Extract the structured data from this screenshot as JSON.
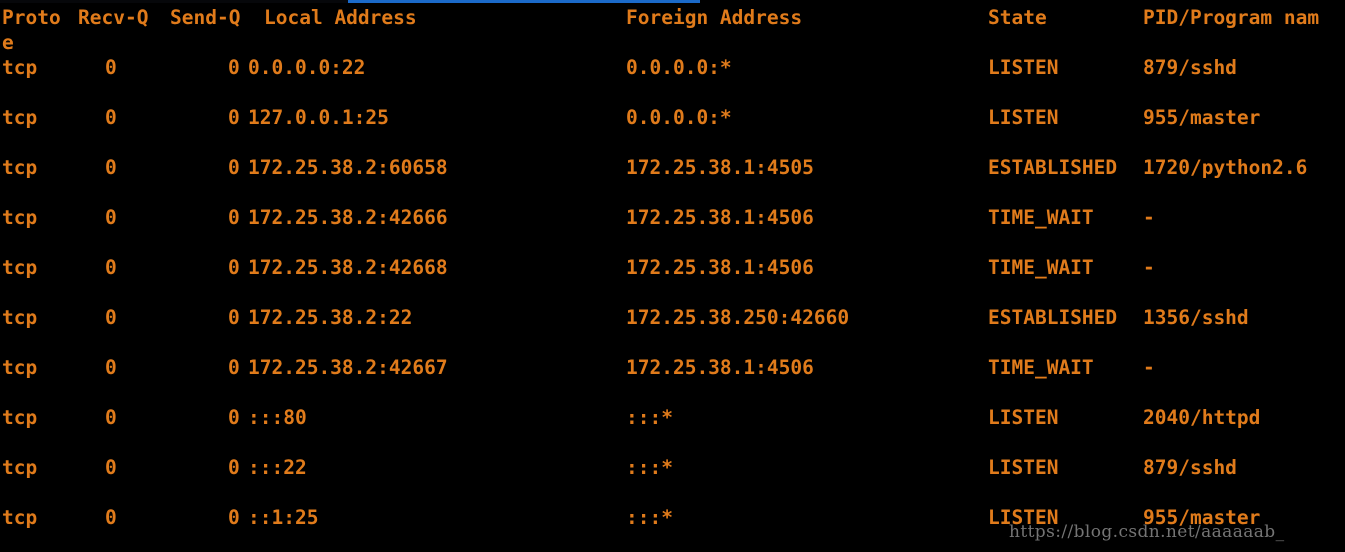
{
  "terminal": {
    "title": "netstat -antulpe output",
    "foreground_color": "#e07b1b",
    "background_color": "#000000",
    "accent_bar_color": "#1b6ac9",
    "watermark_color": "#8e8e8e"
  },
  "table": {
    "headers": {
      "proto": "Proto",
      "recvq": "Recv-Q",
      "sendq": "Send-Q",
      "local_address": "Local Address",
      "foreign_address": "Foreign Address",
      "state": "State",
      "pid_program": "PID/Program nam",
      "pid_program_wrap": "e"
    },
    "rows": [
      {
        "proto": "tcp",
        "recvq": "0",
        "sendq": "0",
        "local_address": "0.0.0.0:22",
        "foreign_address": "0.0.0.0:*",
        "state": "LISTEN",
        "pid_program": "879/sshd"
      },
      {
        "proto": "tcp",
        "recvq": "0",
        "sendq": "0",
        "local_address": "127.0.0.1:25",
        "foreign_address": "0.0.0.0:*",
        "state": "LISTEN",
        "pid_program": "955/master"
      },
      {
        "proto": "tcp",
        "recvq": "0",
        "sendq": "0",
        "local_address": "172.25.38.2:60658",
        "foreign_address": "172.25.38.1:4505",
        "state": "ESTABLISHED",
        "pid_program": "1720/python2.6"
      },
      {
        "proto": "tcp",
        "recvq": "0",
        "sendq": "0",
        "local_address": "172.25.38.2:42666",
        "foreign_address": "172.25.38.1:4506",
        "state": "TIME_WAIT",
        "pid_program": "-"
      },
      {
        "proto": "tcp",
        "recvq": "0",
        "sendq": "0",
        "local_address": "172.25.38.2:42668",
        "foreign_address": "172.25.38.1:4506",
        "state": "TIME_WAIT",
        "pid_program": "-"
      },
      {
        "proto": "tcp",
        "recvq": "0",
        "sendq": "0",
        "local_address": "172.25.38.2:22",
        "foreign_address": "172.25.38.250:42660",
        "state": "ESTABLISHED",
        "pid_program": "1356/sshd"
      },
      {
        "proto": "tcp",
        "recvq": "0",
        "sendq": "0",
        "local_address": "172.25.38.2:42667",
        "foreign_address": "172.25.38.1:4506",
        "state": "TIME_WAIT",
        "pid_program": "-"
      },
      {
        "proto": "tcp",
        "recvq": "0",
        "sendq": "0",
        "local_address": ":::80",
        "foreign_address": ":::*",
        "state": "LISTEN",
        "pid_program": "2040/httpd"
      },
      {
        "proto": "tcp",
        "recvq": "0",
        "sendq": "0",
        "local_address": ":::22",
        "foreign_address": ":::*",
        "state": "LISTEN",
        "pid_program": "879/sshd"
      },
      {
        "proto": "tcp",
        "recvq": "0",
        "sendq": "0",
        "local_address": "::1:25",
        "foreign_address": ":::*",
        "state": "LISTEN",
        "pid_program": "955/master"
      }
    ]
  },
  "watermark": {
    "text": "https://blog.csdn.net/aaaaaab_"
  }
}
